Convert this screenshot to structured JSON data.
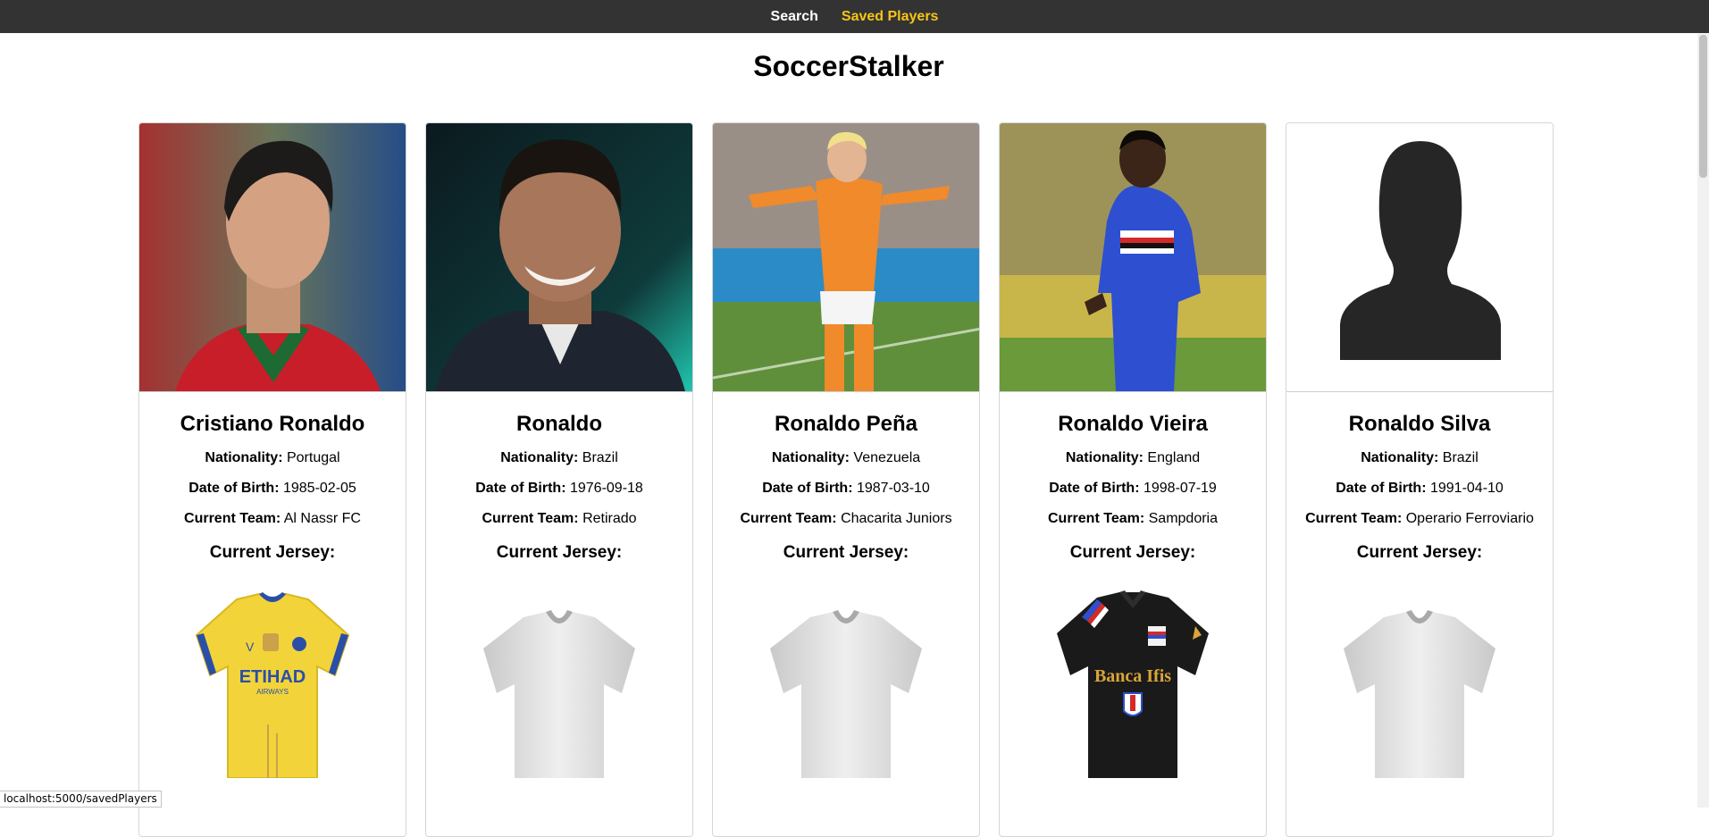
{
  "nav": {
    "search_label": "Search",
    "saved_label": "Saved Players",
    "active_color": "#f5c518"
  },
  "page": {
    "title": "SoccerStalker"
  },
  "labels": {
    "nationality": "Nationality:",
    "dob": "Date of Birth:",
    "team": "Current Team:",
    "jersey": "Current Jersey:"
  },
  "players": [
    {
      "name": "Cristiano Ronaldo",
      "nationality": "Portugal",
      "dob": "1985-02-05",
      "team": "Al Nassr FC",
      "jersey_icon": "al-nassr-jersey-icon"
    },
    {
      "name": "Ronaldo",
      "nationality": "Brazil",
      "dob": "1976-09-18",
      "team": "Retirado",
      "jersey_icon": "generic-jersey-icon"
    },
    {
      "name": "Ronaldo Peña",
      "nationality": "Venezuela",
      "dob": "1987-03-10",
      "team": "Chacarita Juniors",
      "jersey_icon": "generic-jersey-icon"
    },
    {
      "name": "Ronaldo Vieira",
      "nationality": "England",
      "dob": "1998-07-19",
      "team": "Sampdoria",
      "jersey_icon": "sampdoria-jersey-icon"
    },
    {
      "name": "Ronaldo Silva",
      "nationality": "Brazil",
      "dob": "1991-04-10",
      "team": "Operario Ferroviario",
      "jersey_icon": "generic-jersey-icon"
    }
  ],
  "jersey_texts": {
    "al_nassr_sponsor": "ETIHAD",
    "al_nassr_sponsor_sub": "AIRWAYS",
    "sampdoria_sponsor": "Banca Ifis"
  },
  "status_bar": {
    "url": "localhost:5000/savedPlayers"
  }
}
